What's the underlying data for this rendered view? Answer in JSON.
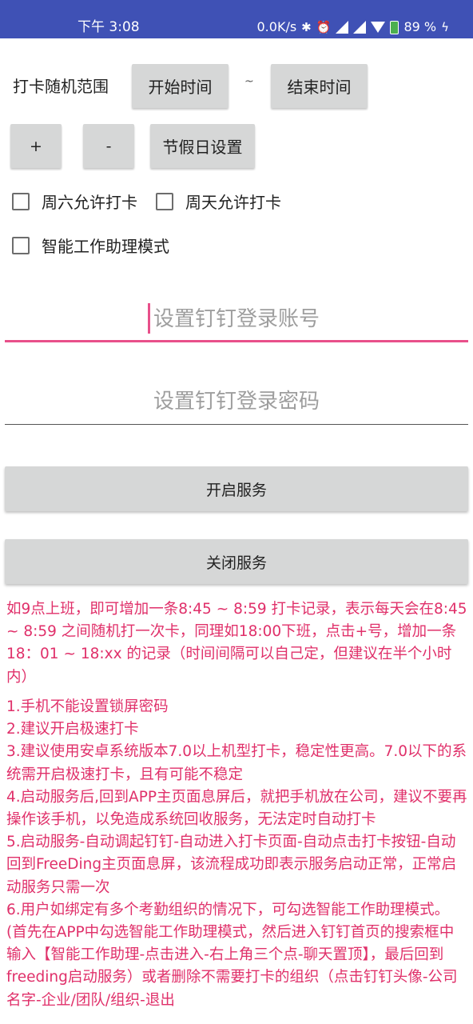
{
  "status_bar": {
    "time": "下午 3:08",
    "net_speed": "0.0K/s",
    "battery": "89 %",
    "icons": [
      "bluetooth-icon",
      "alarm-icon",
      "signal-icon",
      "signal-icon",
      "wifi-icon",
      "battery-icon",
      "charging-icon"
    ]
  },
  "range": {
    "label": "打卡随机范围",
    "start_button": "开始时间",
    "separator": "~",
    "end_button": "结束时间"
  },
  "controls": {
    "plus": "+",
    "minus": "-",
    "holiday": "节假日设置"
  },
  "checkboxes": {
    "saturday": "周六允许打卡",
    "sunday": "周天允许打卡",
    "smart_mode": "智能工作助理模式"
  },
  "inputs": {
    "account_placeholder": "设置钉钉登录账号",
    "password_placeholder": "设置钉钉登录密码"
  },
  "service": {
    "start": "开启服务",
    "stop": "关闭服务"
  },
  "instructions": {
    "intro": "如9点上班，即可增加一条8:45 ~ 8:59 打卡记录，表示每天会在8:45 ~ 8:59 之间随机打一次卡，同理如18:00下班，点击+号，增加一条18：01 ~ 18:xx 的记录（时间间隔可以自己定，但建议在半个小时内）",
    "items": [
      "1.手机不能设置锁屏密码",
      "2.建议开启极速打卡",
      "3.建议使用安卓系统版本7.0以上机型打卡，稳定性更高。7.0以下的系统需开启极速打卡，且有可能不稳定",
      "4.启动服务后,回到APP主页面息屏后，就把手机放在公司，建议不要再操作该手机，以免造成系统回收服务，无法定时自动打卡",
      "5.启动服务-自动调起钉钉-自动进入打卡页面-自动点击打卡按钮-自动回到FreeDing主页面息屏，该流程成功即表示服务启动正常，正常启动服务只需一次",
      "6.用户如绑定有多个考勤组织的情况下，可勾选智能工作助理模式。(首先在APP中勾选智能工作助理模式，然后进入钉钉首页的搜索框中输入【智能工作助理-点击进入-右上角三个点-聊天置顶】，最后回到freeding启动服务）或者删除不需要打卡的组织（点击钉钉头像-公司名字-企业/团队/组织-退出"
    ]
  }
}
